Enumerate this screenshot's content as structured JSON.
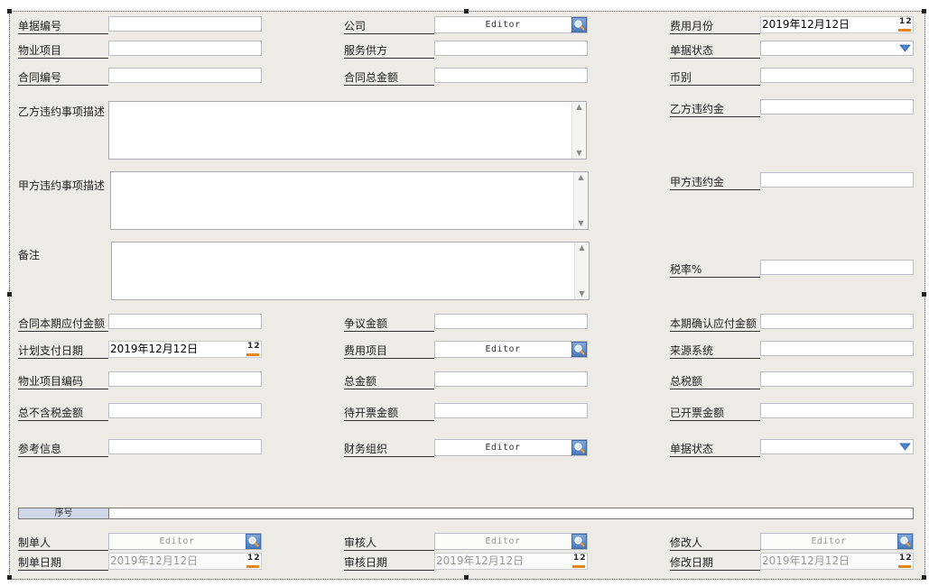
{
  "row1": {
    "doc_no_label": "单据编号",
    "company_label": "公司",
    "company_value": "Editor",
    "expense_month_label": "费用月份",
    "expense_month_value": "2019年12月12日"
  },
  "row2": {
    "property_label": "物业项目",
    "provider_label": "服务供方",
    "status_label": "单据状态"
  },
  "row3": {
    "contract_no_label": "合同编号",
    "contract_total_label": "合同总金额",
    "currency_label": "币别"
  },
  "memo_b": {
    "label": "乙方违约事项描述",
    "penalty_label": "乙方违约金"
  },
  "memo_a": {
    "label": "甲方违约事项描述",
    "penalty_label": "甲方违约金"
  },
  "memo_note": {
    "label": "备注",
    "tax_rate_label": "税率%"
  },
  "row4": {
    "period_payable_label": "合同本期应付金额",
    "dispute_label": "争议金额",
    "confirmed_payable_label": "本期确认应付金额"
  },
  "row5": {
    "plan_date_label": "计划支付日期",
    "plan_date_value": "2019年12月12日",
    "expense_item_label": "费用项目",
    "expense_item_value": "Editor",
    "source_label": "来源系统"
  },
  "row6": {
    "property_code_label": "物业项目编码",
    "total_amount_label": "总金额",
    "total_tax_label": "总税额"
  },
  "row7": {
    "total_excl_tax_label": "总不含税金额",
    "pending_invoice_label": "待开票金额",
    "invoiced_label": "已开票金额"
  },
  "row8": {
    "reference_label": "参考信息",
    "finance_org_label": "财务组织",
    "finance_org_value": "Editor",
    "status2_label": "单据状态"
  },
  "grid": {
    "col_seq": "序号"
  },
  "footer": {
    "creator_label": "制单人",
    "creator_value": "Editor",
    "reviewer_label": "审核人",
    "reviewer_value": "Editor",
    "modifier_label": "修改人",
    "modifier_value": "Editor",
    "create_date_label": "制单日期",
    "create_date_value": "2019年12月12日",
    "review_date_label": "审核日期",
    "review_date_value": "2019年12月12日",
    "modify_date_label": "修改日期",
    "modify_date_value": "2019年12月12日"
  },
  "icons": {
    "lookup": "magnifier-lookup-icon",
    "calendar": "calendar-12-icon",
    "dropdown": "triangle-down-icon",
    "scroll_up": "scroll-up-arrow-icon",
    "scroll_down": "scroll-down-arrow-icon"
  },
  "colors": {
    "panel_bg": "#ecebe6",
    "lookup_blue": "#4a7bc0",
    "calendar_orange": "#e0861b"
  }
}
